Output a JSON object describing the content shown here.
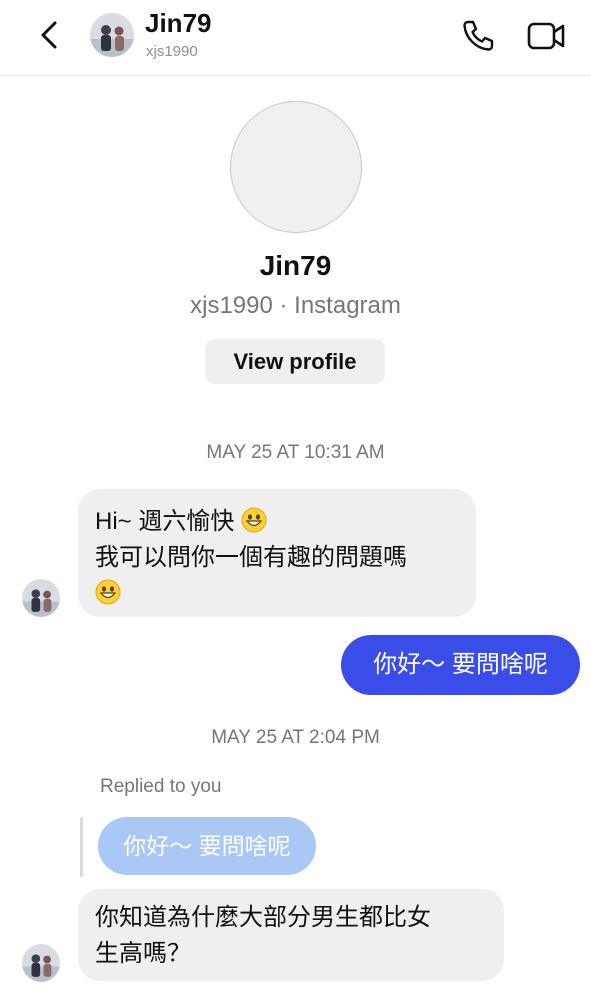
{
  "header": {
    "name": "Jin79",
    "username": "xjs1990",
    "back_icon": "chevron-left-icon",
    "call_icon": "phone-icon",
    "video_icon": "video-camera-icon"
  },
  "profile": {
    "name": "Jin79",
    "subtitle": "xjs1990 · Instagram",
    "view_profile_label": "View profile"
  },
  "messages": {
    "stamp1": "MAY 25 AT 10:31 AM",
    "msg1_line1": "Hi~ 週六愉快",
    "msg1_line2": "我可以問你一個有趣的問題嗎",
    "sent1": "你好～ 要問啥呢",
    "stamp2": "MAY 25 AT 2:04 PM",
    "replied_label": "Replied to you",
    "replied_quote": "你好～ 要問啥呢",
    "msg2_line1": "你知道為什麼大部分男生都比女",
    "msg2_line2": "生高嗎？"
  },
  "colors": {
    "sent_bubble": "#3a4de8",
    "received_bubble": "#efefef",
    "reply_quote_bubble": "#a9c8f5"
  }
}
